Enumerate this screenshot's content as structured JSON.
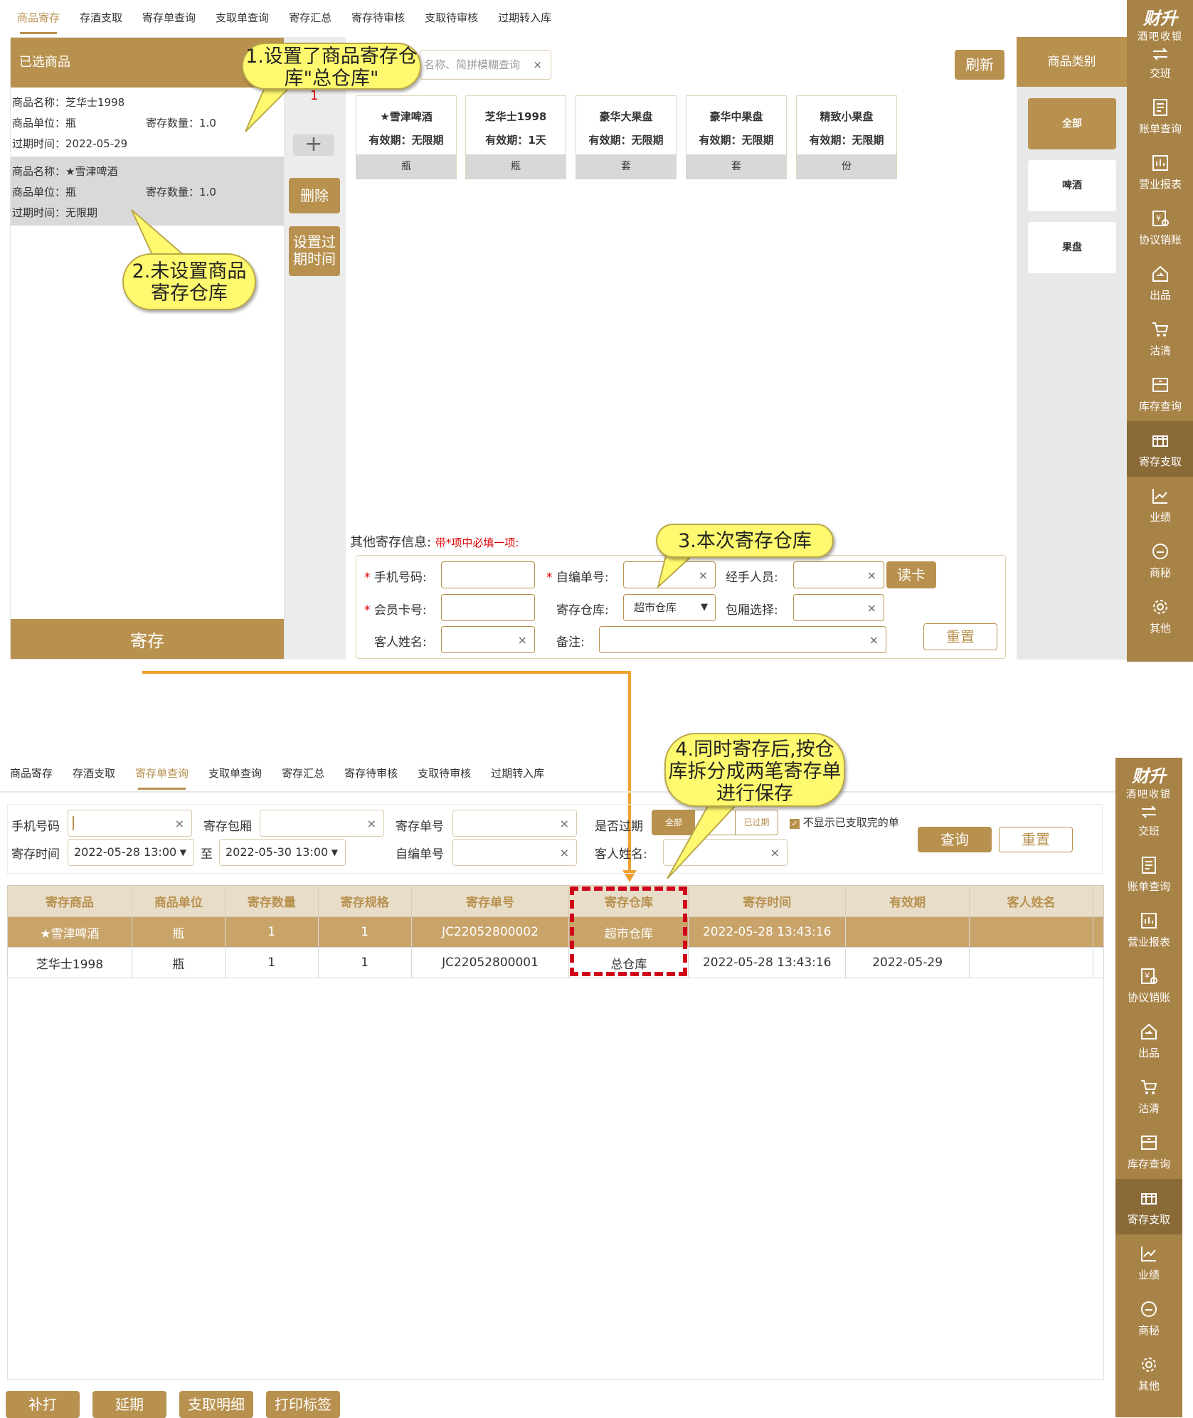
{
  "top_tabs": [
    "商品寄存",
    "存酒支取",
    "寄存单查询",
    "支取单查询",
    "寄存汇总",
    "寄存待审核",
    "支取待审核",
    "过期转入库"
  ],
  "bottom_tabs": [
    "商品寄存",
    "存酒支取",
    "寄存单查询",
    "支取单查询",
    "寄存汇总",
    "寄存待审核",
    "支取待审核",
    "过期转入库"
  ],
  "sidebar": {
    "logo_line1": "财升",
    "logo_line2": "酒吧收银",
    "items": [
      "交班",
      "账单查询",
      "营业报表",
      "协议销账",
      "出品",
      "沽清",
      "库存查询",
      "寄存支取",
      "业绩",
      "商秘",
      "其他"
    ],
    "active": "寄存支取"
  },
  "selected_panel": {
    "title": "已选商品",
    "items": [
      {
        "name_label": "商品名称：",
        "name": "芝华士1998",
        "unit_label": "商品单位：",
        "unit": "瓶",
        "qty_label": "寄存数量：",
        "qty": "1.0",
        "expire_label": "过期时间：",
        "expire": "2022-05-29"
      },
      {
        "name_label": "商品名称：",
        "name": "★雪津啤酒",
        "unit_label": "商品单位：",
        "unit": "瓶",
        "qty_label": "寄存数量：",
        "qty": "1.0",
        "expire_label": "过期时间：",
        "expire": "无限期"
      }
    ],
    "deposit_button": "寄存"
  },
  "middle": {
    "badge": "1",
    "plus": "+",
    "delete_button": "删除",
    "set_expire_button": "设置过期时间"
  },
  "search": {
    "placeholder": "名称、简拼模糊查询",
    "refresh": "刷新"
  },
  "products": [
    {
      "name": "★雪津啤酒",
      "validity": "有效期：无限期",
      "unit": "瓶"
    },
    {
      "name": "芝华士1998",
      "validity": "有效期：1天",
      "unit": "瓶"
    },
    {
      "name": "豪华大果盘",
      "validity": "有效期：无限期",
      "unit": "套"
    },
    {
      "name": "豪华中果盘",
      "validity": "有效期：无限期",
      "unit": "套"
    },
    {
      "name": "精致小果盘",
      "validity": "有效期：无限期",
      "unit": "份"
    }
  ],
  "categories": {
    "title": "商品类别",
    "items": [
      "全部",
      "啤酒",
      "果盘"
    ]
  },
  "form": {
    "title": "其他寄存信息:",
    "hint": "带*项中必填一项:",
    "phone_label": "手机号码:",
    "custom_no_label": "自编单号:",
    "handler_label": "经手人员:",
    "read_card": "读卡",
    "member_label": "会员卡号:",
    "warehouse_label": "寄存仓库:",
    "warehouse_value": "超市仓库",
    "room_label": "包厢选择:",
    "guest_label": "客人姓名:",
    "note_label": "备注:",
    "reset": "重置"
  },
  "callouts": {
    "c1": "1.设置了商品寄存仓库\"总仓库\"",
    "c2": "2.未设置商品寄存仓库",
    "c3": "3.本次寄存仓库",
    "c4": "4.同时寄存后,按仓库拆分成两笔寄存单进行保存"
  },
  "query": {
    "phone_label": "手机号码",
    "room_label": "寄存包厢",
    "order_no_label": "寄存单号",
    "expired_label": "是否过期",
    "seg_all": "全部",
    "seg_expired": "已过期",
    "hide_done": "不显示已支取完的单",
    "time_label": "寄存时间",
    "time_from": "2022-05-28 13:00",
    "to": "至",
    "time_to": "2022-05-30 13:00",
    "custom_no_label": "自编单号",
    "guest_label": "客人姓名:",
    "search": "查询",
    "reset": "重置"
  },
  "table": {
    "headers": [
      "寄存商品",
      "商品单位",
      "寄存数量",
      "寄存规格",
      "寄存单号",
      "寄存仓库",
      "寄存时间",
      "有效期",
      "客人姓名"
    ],
    "rows": [
      [
        "★雪津啤酒",
        "瓶",
        "1",
        "1",
        "JC22052800002",
        "超市仓库",
        "2022-05-28 13:43:16",
        "",
        ""
      ],
      [
        "芝华士1998",
        "瓶",
        "1",
        "1",
        "JC22052800001",
        "总仓库",
        "2022-05-28 13:43:16",
        "2022-05-29",
        ""
      ]
    ]
  },
  "bottom_buttons": [
    "补打",
    "延期",
    "支取明细",
    "打印标签"
  ],
  "colors": {
    "gold": "#b8914f",
    "sidebar": "#a88347",
    "callout": "#fef96e",
    "dash": "#d0021b",
    "arrow": "#f0a030"
  }
}
